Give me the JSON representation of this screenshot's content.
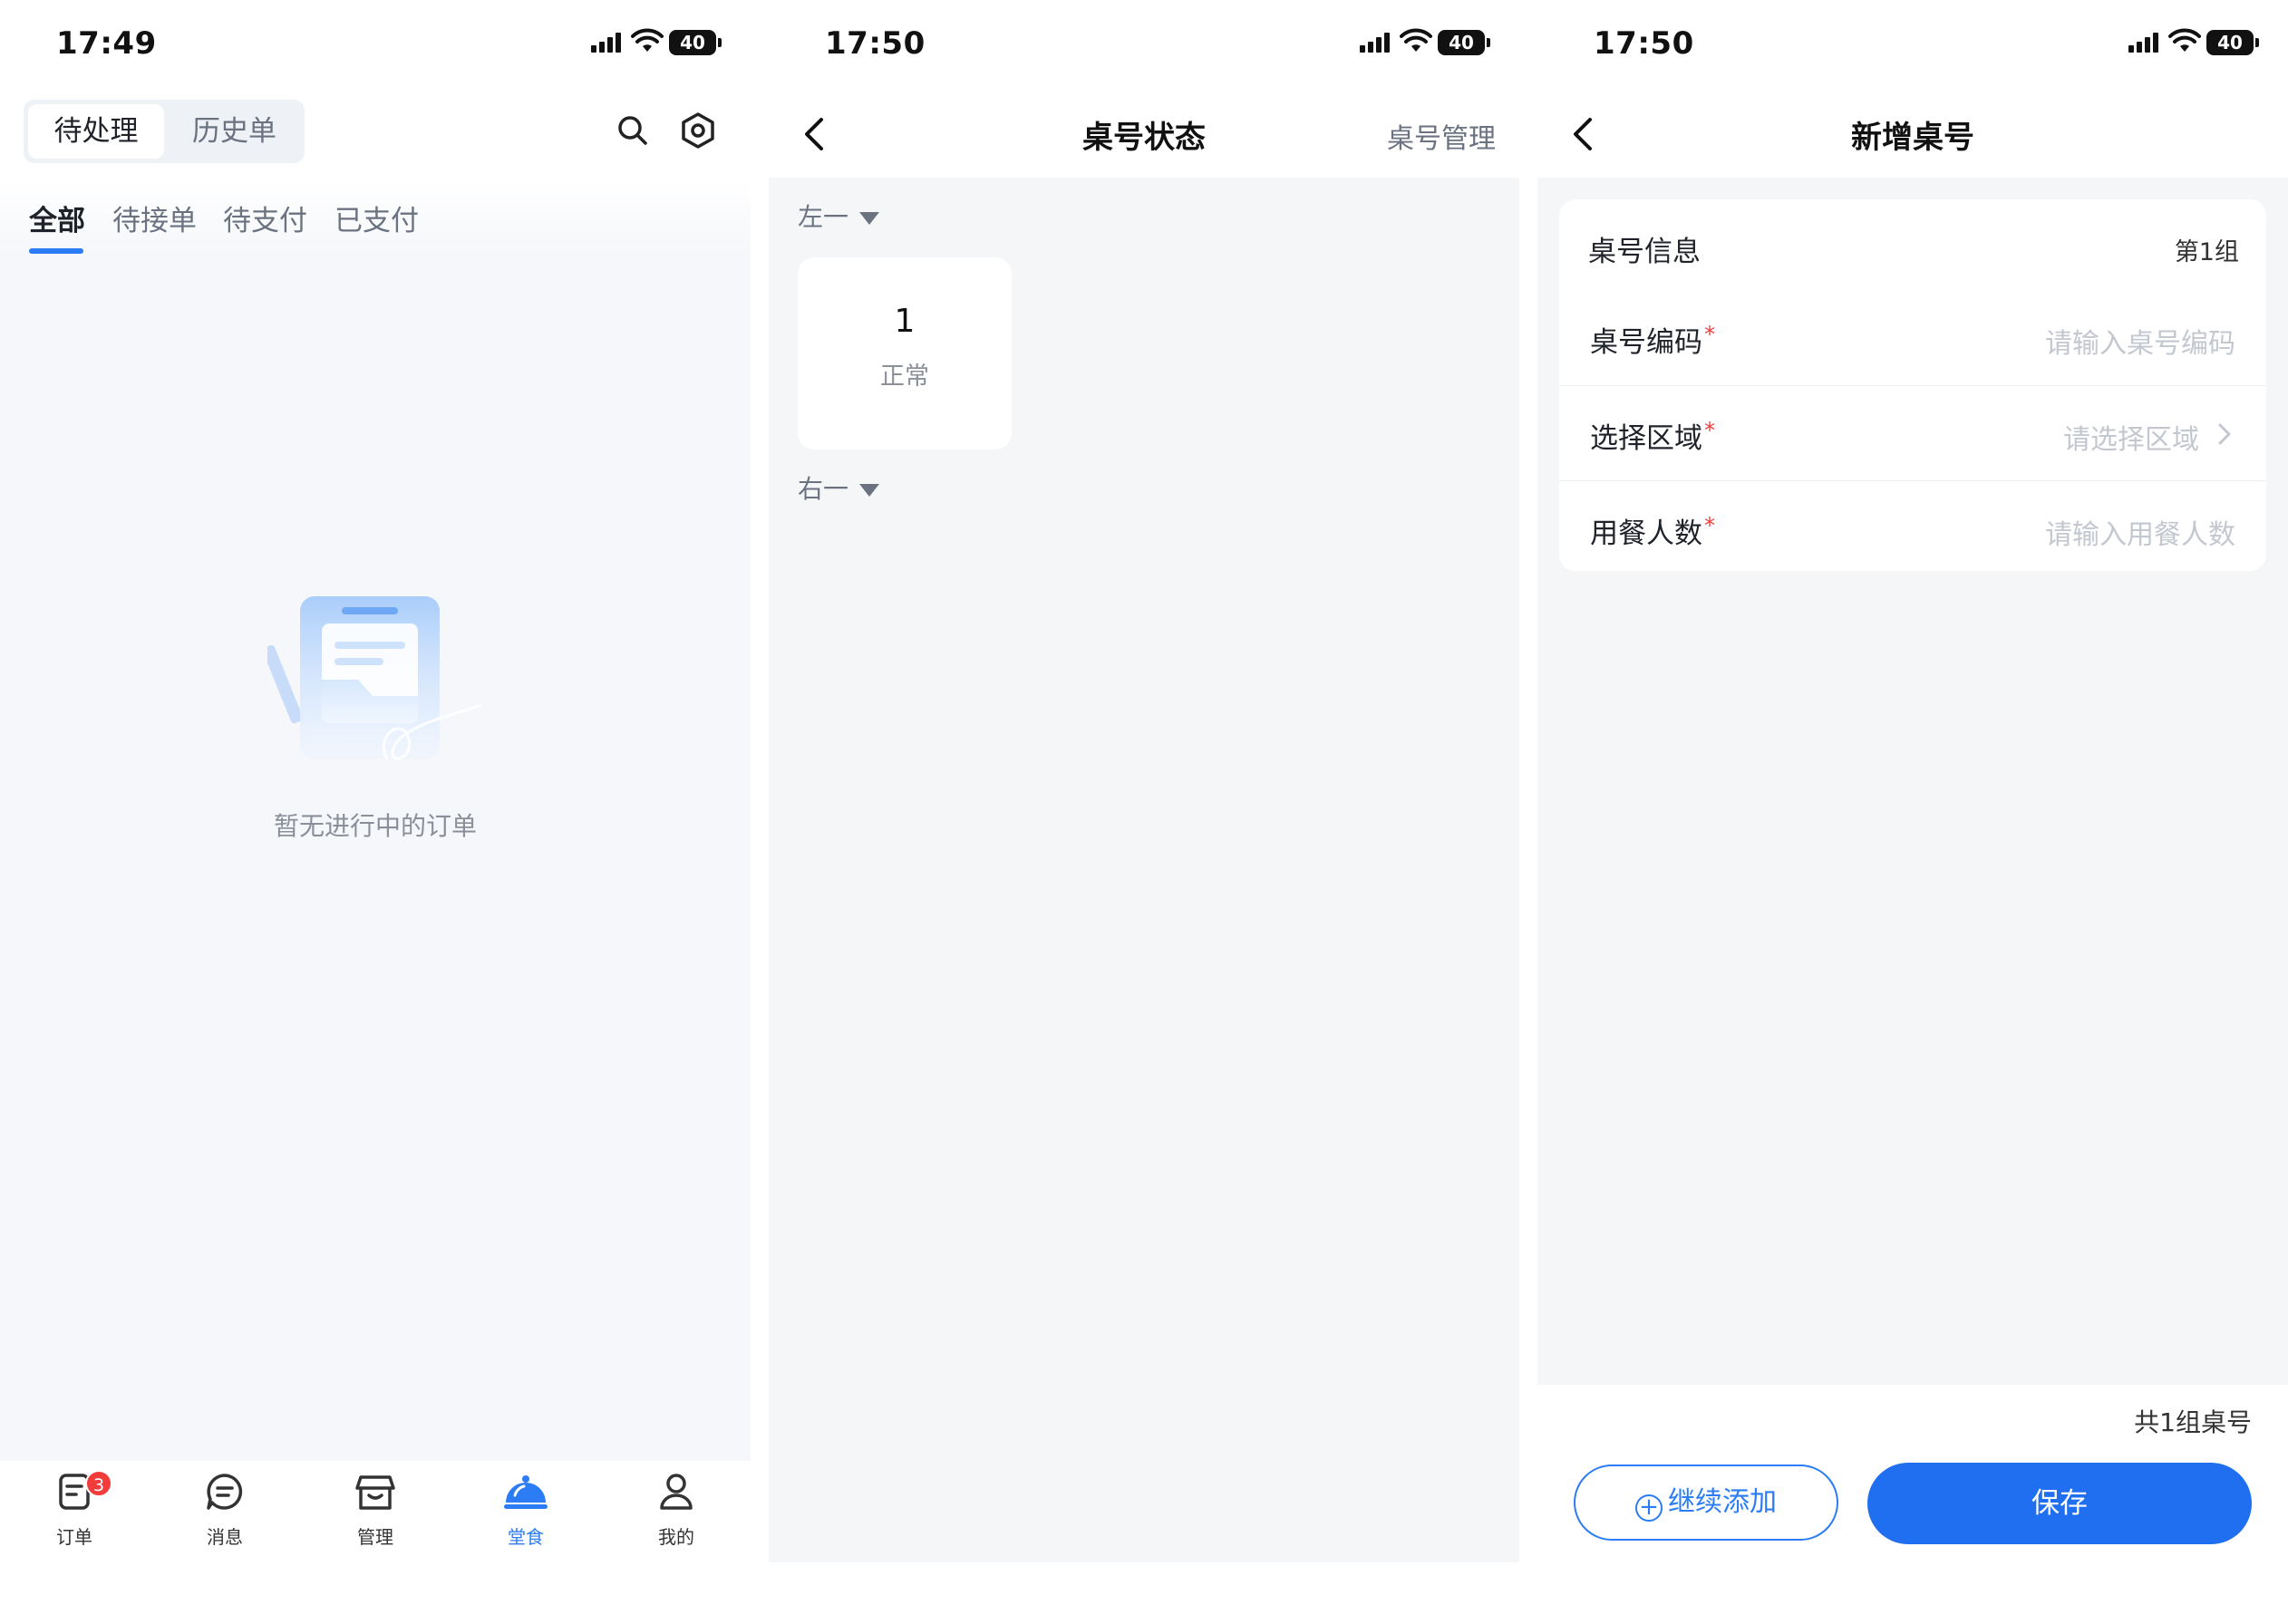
{
  "screen1": {
    "status_time": "17:49",
    "battery": "40",
    "segment": [
      "待处理",
      "历史单"
    ],
    "tabs": [
      "全部",
      "待接单",
      "待支付",
      "已支付"
    ],
    "empty_text": "暂无进行中的订单",
    "nav": [
      {
        "label": "订单",
        "icon": "order-icon",
        "badge": "3"
      },
      {
        "label": "消息",
        "icon": "message-icon"
      },
      {
        "label": "管理",
        "icon": "store-icon"
      },
      {
        "label": "堂食",
        "icon": "cloche-icon"
      },
      {
        "label": "我的",
        "icon": "user-icon"
      }
    ],
    "active_nav": "堂食",
    "accent": "#2b7cf5"
  },
  "screen2": {
    "status_time": "17:50",
    "battery": "40",
    "title": "桌号状态",
    "right_action": "桌号管理",
    "groups": [
      {
        "name": "左一",
        "tables": [
          {
            "number": "1",
            "status": "正常"
          }
        ]
      },
      {
        "name": "右一",
        "tables": []
      }
    ]
  },
  "screen3": {
    "status_time": "17:50",
    "battery": "40",
    "title": "新增桌号",
    "section_title": "桌号信息",
    "section_group": "第1组",
    "fields": [
      {
        "label": "桌号编码",
        "required": "*",
        "placeholder": "请输入桌号编码"
      },
      {
        "label": "选择区域",
        "required": "*",
        "placeholder": "请选择区域"
      },
      {
        "label": "用餐人数",
        "required": "*",
        "placeholder": "请输入用餐人数"
      }
    ],
    "summary": "共1组桌号",
    "continue_label": "继续添加",
    "save_label": "保存",
    "save_color": "#1f6ff0"
  }
}
